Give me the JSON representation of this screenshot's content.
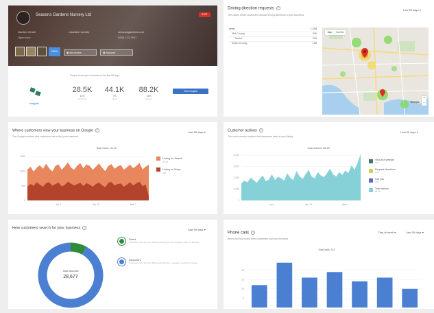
{
  "business_card": {
    "header_title": "Seasons Gardens Nursery Ltd",
    "header_sub_1": "Garden Center",
    "header_sub_2": "Open now",
    "header_sub_3": "Updated recently",
    "header_sub_4": "seasonsgardens.com",
    "header_sub_5": "(555) 123-4567",
    "edit_label": "EDIT",
    "btn_view": "VIEW",
    "btn_add_photos": "Add photos",
    "btn_add_posts": "Add post",
    "insights_caption": "People found your business in the last 28 days",
    "insights_label": "Insights",
    "stats": [
      {
        "value": "28.5K",
        "delta": "11%",
        "sub": "searches"
      },
      {
        "value": "44.1K",
        "delta": "7%",
        "sub": "views"
      },
      {
        "value": "88.2K",
        "delta": "13%",
        "sub": "actions"
      }
    ],
    "view_insights_button": "View insights"
  },
  "driving": {
    "title": "Driving direction requests",
    "link": "Last 90 days",
    "subtitle": "The places where customers request driving directions to your business",
    "rows": [
      {
        "label": "Area",
        "value": "1,234"
      },
      {
        "label": "Mid County",
        "value": "345"
      },
      {
        "label": "Tamba",
        "value": "203"
      },
      {
        "label": "Kasto County",
        "value": "188"
      }
    ],
    "map_tabs": [
      "Map",
      "Satellite"
    ],
    "city": "Tampa",
    "colors": {
      "water": "#a9cfee",
      "land": "#e8e6df",
      "road": "#f7d980",
      "pin": "#d93025",
      "heat_green": "#7ed957",
      "heat_yellow": "#f3d74c"
    }
  },
  "views": {
    "title": "Where customers view your business on Google",
    "link": "Last 90 days",
    "subtitle": "The Google services that customers use to find your business",
    "total": "Total views: 44.1K",
    "legend": [
      {
        "label": "Listing on Search",
        "sub": "20.1K",
        "color": "#e8865d"
      },
      {
        "label": "Listing on Maps",
        "sub": "24K",
        "color": "#b4432c"
      }
    ],
    "y_ticks": [
      "1,500",
      "1,000",
      "500",
      "0"
    ],
    "x_ticks": [
      "Apr 1",
      "Apr 15",
      "May 1"
    ]
  },
  "actions": {
    "title": "Customer actions",
    "link": "Last 90 days",
    "subtitle": "The most common actions that customers take on your listing",
    "total": "Total actions: 88.2K",
    "legend": [
      {
        "label": "Visit your website",
        "sub": "14K",
        "color": "#3b7b6b"
      },
      {
        "label": "Request directions",
        "sub": "9.1K",
        "color": "#c9d94b"
      },
      {
        "label": "Call you",
        "sub": "2.6K",
        "color": "#5d6bc4"
      },
      {
        "label": "Total actions",
        "sub": "88.2K",
        "color": "#86d0d8"
      }
    ],
    "y_ticks": [
      "4,000",
      "3,000",
      "2,000",
      "1,000",
      "0"
    ],
    "x_ticks": [
      "Apr 1",
      "Apr 15",
      "May 1"
    ]
  },
  "searches": {
    "title": "How customers search for your business",
    "link": "Last 90 days",
    "center_label": "Total searches",
    "center_value": "28,677",
    "legend": [
      {
        "label": "Direct",
        "sub": "Customers who find your listing searching for your business name or address",
        "color": "#2e8b3a"
      },
      {
        "label": "Discovery",
        "sub": "Customers who find your listing searching for a category, product or service",
        "color": "#4a7fd1"
      }
    ],
    "slices": [
      {
        "name": "Direct",
        "value": 8
      },
      {
        "name": "Discovery",
        "value": 92
      }
    ]
  },
  "calls": {
    "title": "Phone calls",
    "link": "Day of week",
    "link2": "Last 90 days",
    "subtitle": "When and how many times customers call your business",
    "total": "Total calls: 110",
    "y_ticks": [
      "20",
      "15",
      "10",
      "5"
    ]
  },
  "chart_data": [
    {
      "type": "bar",
      "title": "Phone calls",
      "categories": [
        "Sun",
        "Mon",
        "Tue",
        "Wed",
        "Thu",
        "Fri",
        "Sat"
      ],
      "values": [
        12,
        24,
        16,
        19,
        14,
        16,
        10
      ],
      "ylim": [
        0,
        25
      ]
    },
    {
      "type": "pie",
      "title": "How customers search for your business",
      "labels": [
        "Direct",
        "Discovery"
      ],
      "values": [
        8,
        92
      ]
    },
    {
      "type": "area",
      "title": "Where customers view your business on Google",
      "series": [
        {
          "name": "Listing on Search",
          "values": [
            1050,
            1150,
            980,
            1120,
            1200,
            1080,
            1250,
            1100,
            990,
            1180,
            1230,
            1050,
            1160,
            1300,
            1120,
            1050,
            1190,
            1270,
            1100,
            1230,
            1180,
            1050,
            1150,
            1260,
            1120,
            1000,
            1180,
            1240,
            1080,
            1160,
            1210,
            1050,
            1140,
            1220,
            1100,
            1180,
            1280,
            1060,
            1150,
            1220
          ]
        },
        {
          "name": "Listing on Maps",
          "values": [
            480,
            560,
            500,
            620,
            540,
            470,
            590,
            620,
            500,
            560,
            610,
            480,
            530,
            640,
            570,
            510,
            560,
            600,
            490,
            590,
            540,
            470,
            560,
            610,
            520,
            450,
            600,
            630,
            510,
            560,
            580,
            470,
            540,
            620,
            510,
            580,
            640,
            490,
            540,
            150
          ]
        }
      ],
      "ylim": [
        0,
        1500
      ]
    },
    {
      "type": "area",
      "title": "Customer actions",
      "series": [
        {
          "name": "Total actions",
          "values": [
            1500,
            1750,
            1600,
            2000,
            1800,
            1550,
            1900,
            2200,
            1700,
            1850,
            2300,
            1800,
            2100,
            1950,
            1750,
            2400,
            2000,
            1800,
            2600,
            2150,
            1900,
            2300,
            2700,
            2100,
            1950,
            2500,
            2200,
            2050,
            2400,
            2800,
            2300,
            2100,
            2500,
            2250,
            2650,
            2400,
            3100,
            2700,
            3300,
            4100
          ]
        }
      ],
      "ylim": [
        0,
        4000
      ]
    }
  ]
}
